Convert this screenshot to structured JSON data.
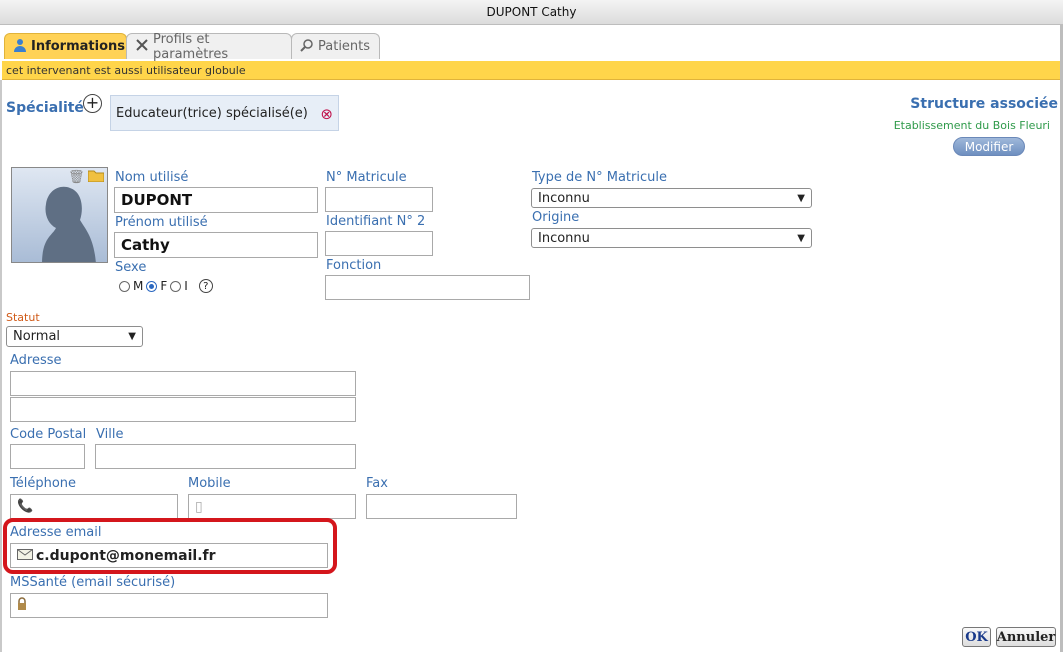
{
  "window": {
    "title": "DUPONT Cathy"
  },
  "tabs": [
    {
      "label": "Informations",
      "icon": "person-icon",
      "active": true
    },
    {
      "label": "Profils et paramètres",
      "icon": "tools-icon",
      "active": false
    },
    {
      "label": "Patients",
      "icon": "search-icon",
      "active": false
    }
  ],
  "banner": {
    "text": "cet intervenant est aussi utilisateur globule"
  },
  "specialite": {
    "label": "Spécialité",
    "value": "Educateur(trice) spécialisé(e)"
  },
  "structure": {
    "title": "Structure associée",
    "etablissement": "Etablissement du Bois Fleuri",
    "modifier_label": "Modifier"
  },
  "identity": {
    "nom_label": "Nom utilisé",
    "nom_value": "DUPONT",
    "prenom_label": "Prénom utilisé",
    "prenom_value": "Cathy",
    "sexe_label": "Sexe",
    "sexe_options": {
      "m": "M",
      "f": "F",
      "i": "I"
    },
    "sexe_selected": "F",
    "help_glyph": "?"
  },
  "matricule": {
    "label": "N° Matricule",
    "value": ""
  },
  "identifiant2": {
    "label": "Identifiant N° 2",
    "value": ""
  },
  "fonction": {
    "label": "Fonction",
    "value": ""
  },
  "type_matricule": {
    "label": "Type de N° Matricule",
    "value": "Inconnu"
  },
  "origine": {
    "label": "Origine",
    "value": "Inconnu"
  },
  "statut": {
    "label": "Statut",
    "value": "Normal"
  },
  "adresse": {
    "label": "Adresse",
    "line1": "",
    "line2": ""
  },
  "code_postal": {
    "label": "Code Postal",
    "value": ""
  },
  "ville": {
    "label": "Ville",
    "value": ""
  },
  "telephone": {
    "label": "Téléphone",
    "value": ""
  },
  "mobile": {
    "label": "Mobile",
    "value": ""
  },
  "fax": {
    "label": "Fax",
    "value": ""
  },
  "email": {
    "label": "Adresse email",
    "value": "c.dupont@monemail.fr"
  },
  "mssante": {
    "label": "MSSanté (email sécurisé)",
    "value": ""
  },
  "footer": {
    "ok_label": "OK",
    "cancel_label": "Annuler"
  },
  "colors": {
    "accent_tab": "#ffd257",
    "label_blue": "#3a6fb0",
    "highlight_red": "#d4161c",
    "statut_orange": "#d05a18"
  }
}
